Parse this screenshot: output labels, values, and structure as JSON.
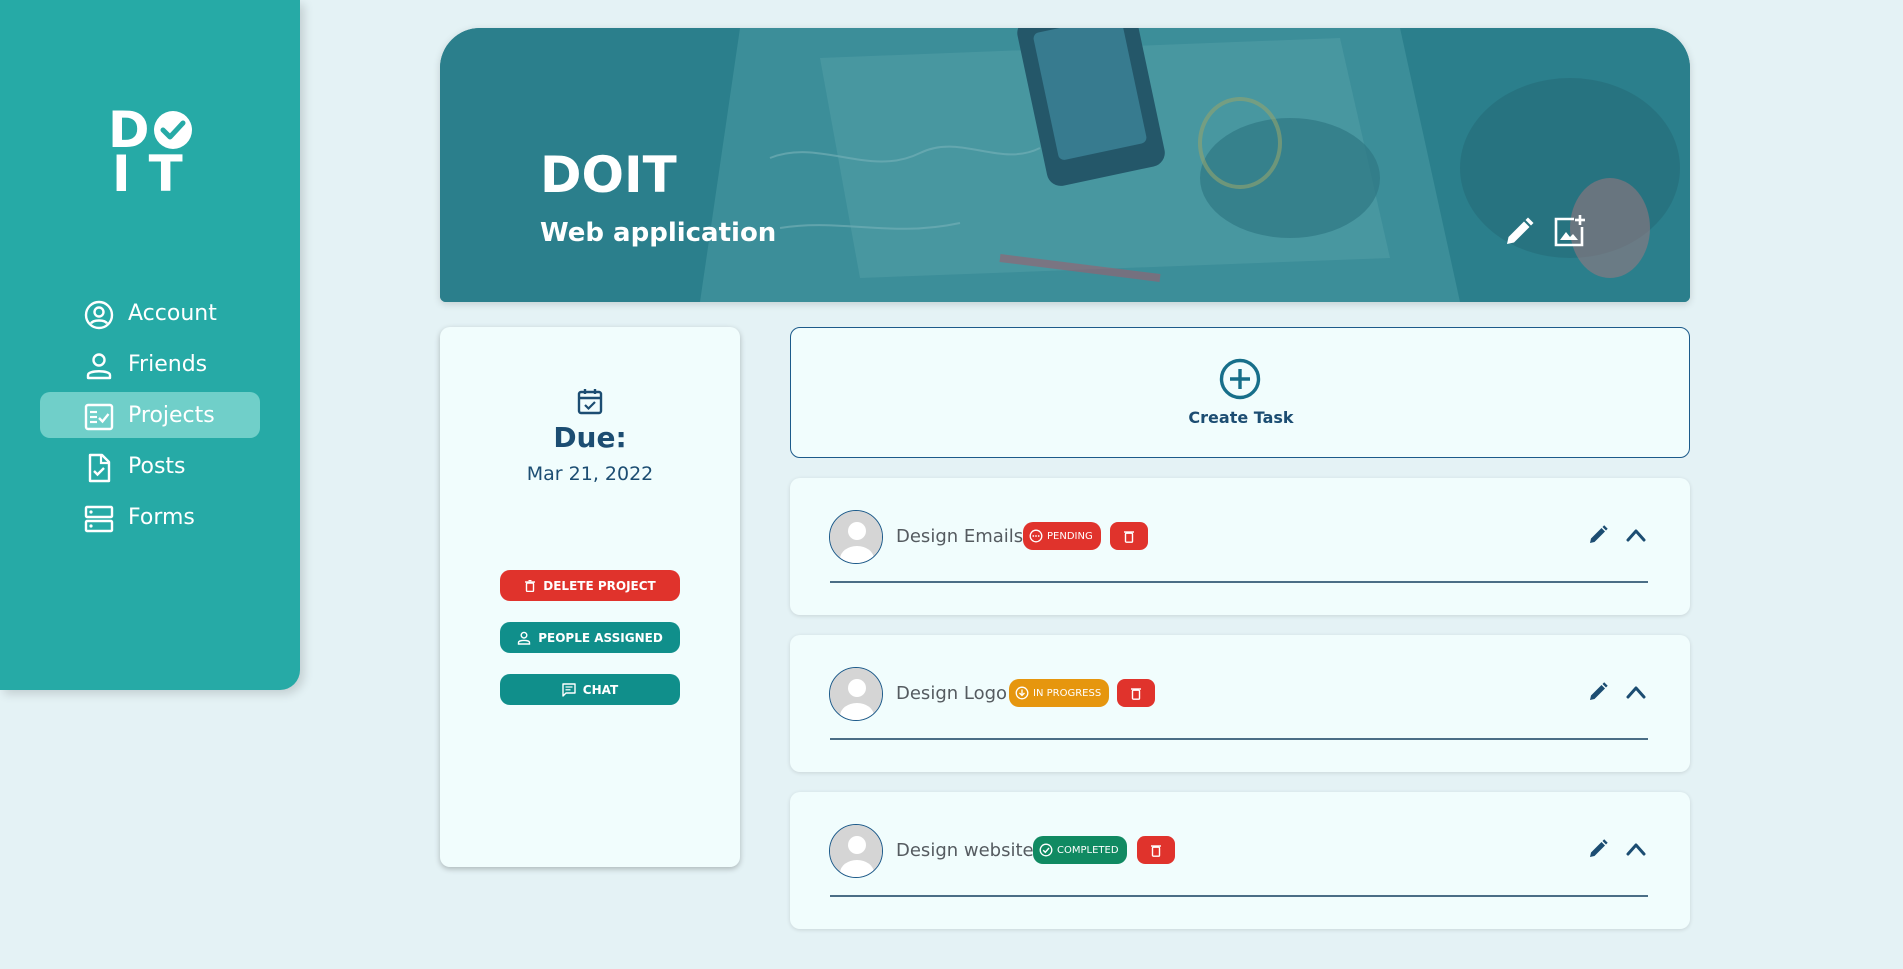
{
  "sidebar": {
    "logo": {
      "line1": "D",
      "line2": "IT"
    },
    "items": [
      {
        "label": "Account",
        "icon": "account-circle-icon",
        "active": false
      },
      {
        "label": "Friends",
        "icon": "person-icon",
        "active": false
      },
      {
        "label": "Projects",
        "icon": "checklist-icon",
        "active": true
      },
      {
        "label": "Posts",
        "icon": "document-check-icon",
        "active": false
      },
      {
        "label": "Forms",
        "icon": "storage-icon",
        "active": false
      }
    ]
  },
  "banner": {
    "title": "DOIT",
    "subtitle": "Web application",
    "edit_icon": "pencil-icon",
    "image_icon": "add-image-icon"
  },
  "project": {
    "due_label": "Due:",
    "due_date": "Mar 21, 2022",
    "delete_label": "DELETE PROJECT",
    "people_label": "PEOPLE ASSIGNED",
    "chat_label": "CHAT"
  },
  "create_task": {
    "label": "Create Task"
  },
  "tasks": [
    {
      "name": "Design Emails",
      "status": "PENDING"
    },
    {
      "name": "Design Logo",
      "status": "IN PROGRESS"
    },
    {
      "name": "Design website",
      "status": "COMPLETED"
    }
  ],
  "colors": {
    "sidebar": "#26aaa6",
    "active_nav": "#70cfc9",
    "background": "#e4f2f5",
    "danger": "#e0332c",
    "teal_button": "#108f8b",
    "in_progress": "#e6960e",
    "completed": "#108a62",
    "navy": "#1c4d72"
  }
}
